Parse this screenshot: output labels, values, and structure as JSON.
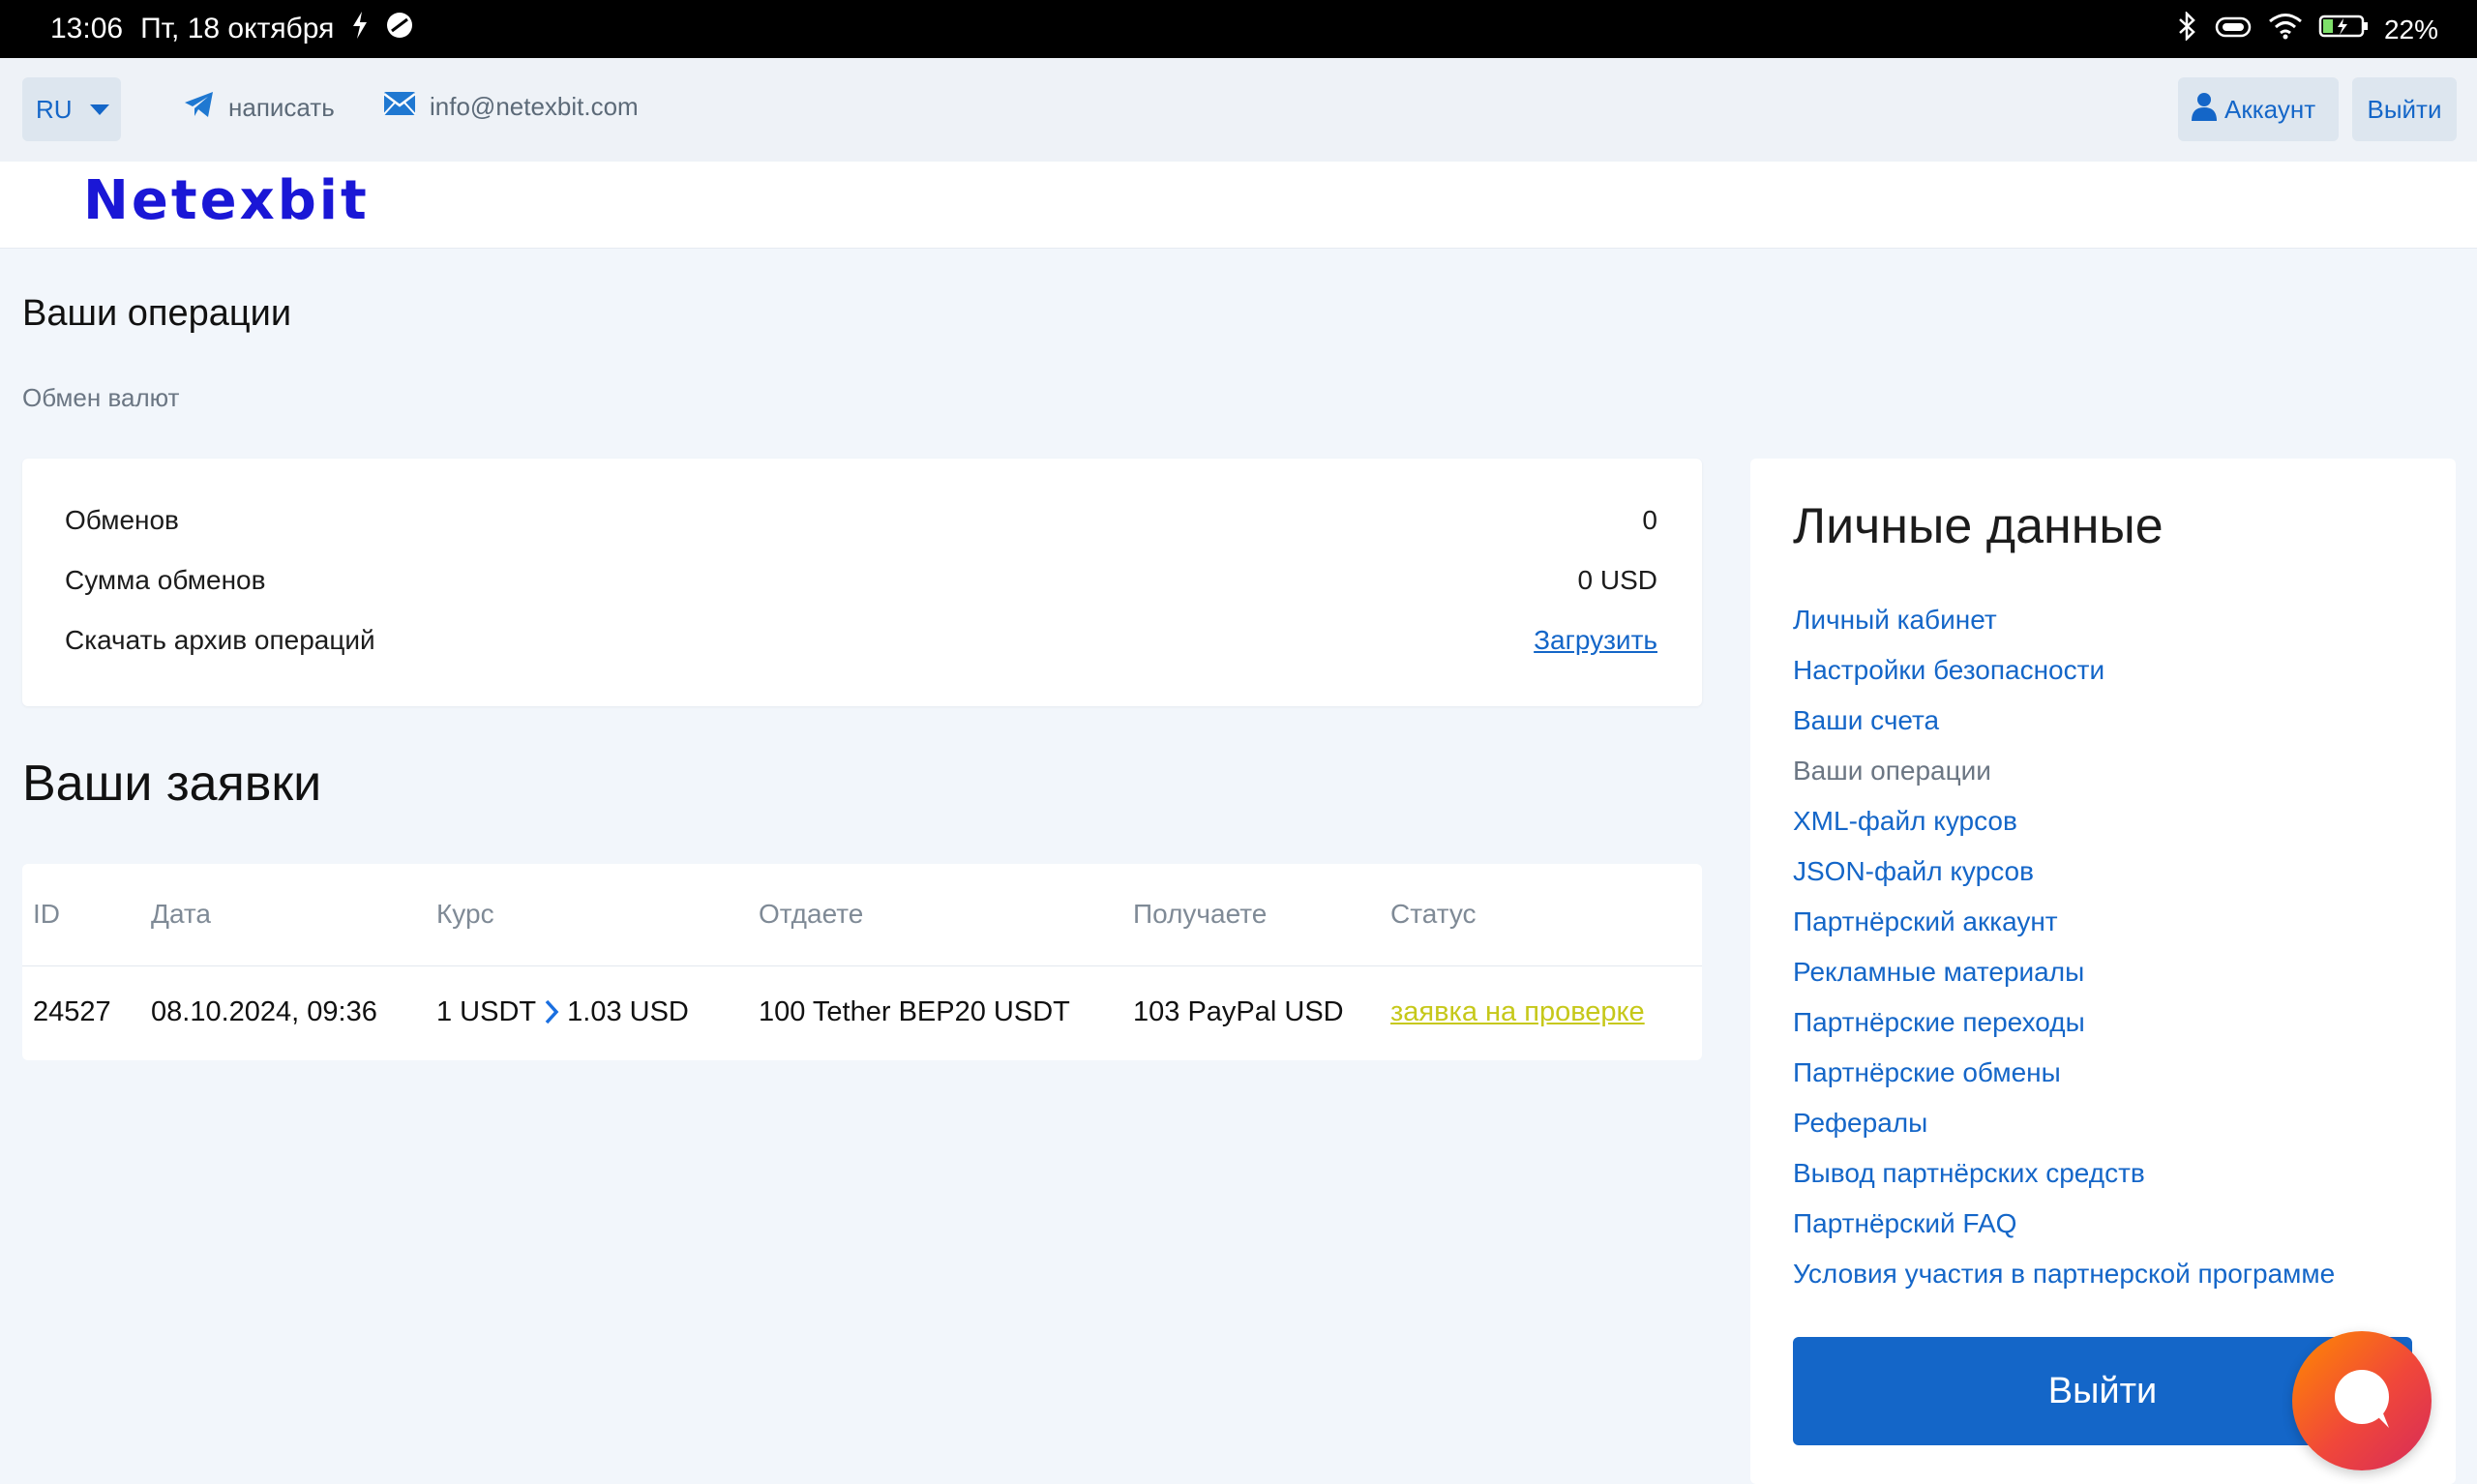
{
  "status_bar": {
    "time": "13:06",
    "date": "Пт, 18 октября",
    "battery": "22%"
  },
  "top": {
    "lang": "RU",
    "telegram_label": "написать",
    "email": "info@netexbit.com",
    "account_label": "Аккаунт",
    "logout_label": "Выйти"
  },
  "logo": "Netexbit",
  "page": {
    "title": "Ваши операции",
    "breadcrumb": "Обмен валют"
  },
  "stats": {
    "exchanges_label": "Обменов",
    "exchanges_value": "0",
    "sum_label": "Сумма обменов",
    "sum_value": "0 USD",
    "archive_label": "Скачать архив операций",
    "archive_link": "Загрузить"
  },
  "orders": {
    "title": "Ваши заявки",
    "headers": [
      "ID",
      "Дата",
      "Курс",
      "Отдаете",
      "Получаете",
      "Статус"
    ],
    "rows": [
      {
        "id": "24527",
        "date": "08.10.2024, 09:36",
        "rate_from": "1 USDT",
        "rate_to": "1.03 USD",
        "give": "100 Tether BEP20 USDT",
        "get": "103 PayPal USD",
        "status": "заявка на проверке"
      }
    ]
  },
  "sidebar": {
    "title": "Личные данные",
    "items": [
      "Личный кабинет",
      "Настройки безопасности",
      "Ваши счета",
      "Ваши операции",
      "XML-файл курсов",
      "JSON-файл курсов",
      "Партнёрский аккаунт",
      "Рекламные материалы",
      "Партнёрские переходы",
      "Партнёрские обмены",
      "Рефералы",
      "Вывод партнёрских средств",
      "Партнёрский FAQ",
      "Условия участия в партнерской программе"
    ],
    "current_index": 3,
    "logout_label": "Выйти"
  },
  "colors": {
    "accent": "#1466c8",
    "status_pending": "#c6c81a",
    "logo": "#1a17d6"
  }
}
